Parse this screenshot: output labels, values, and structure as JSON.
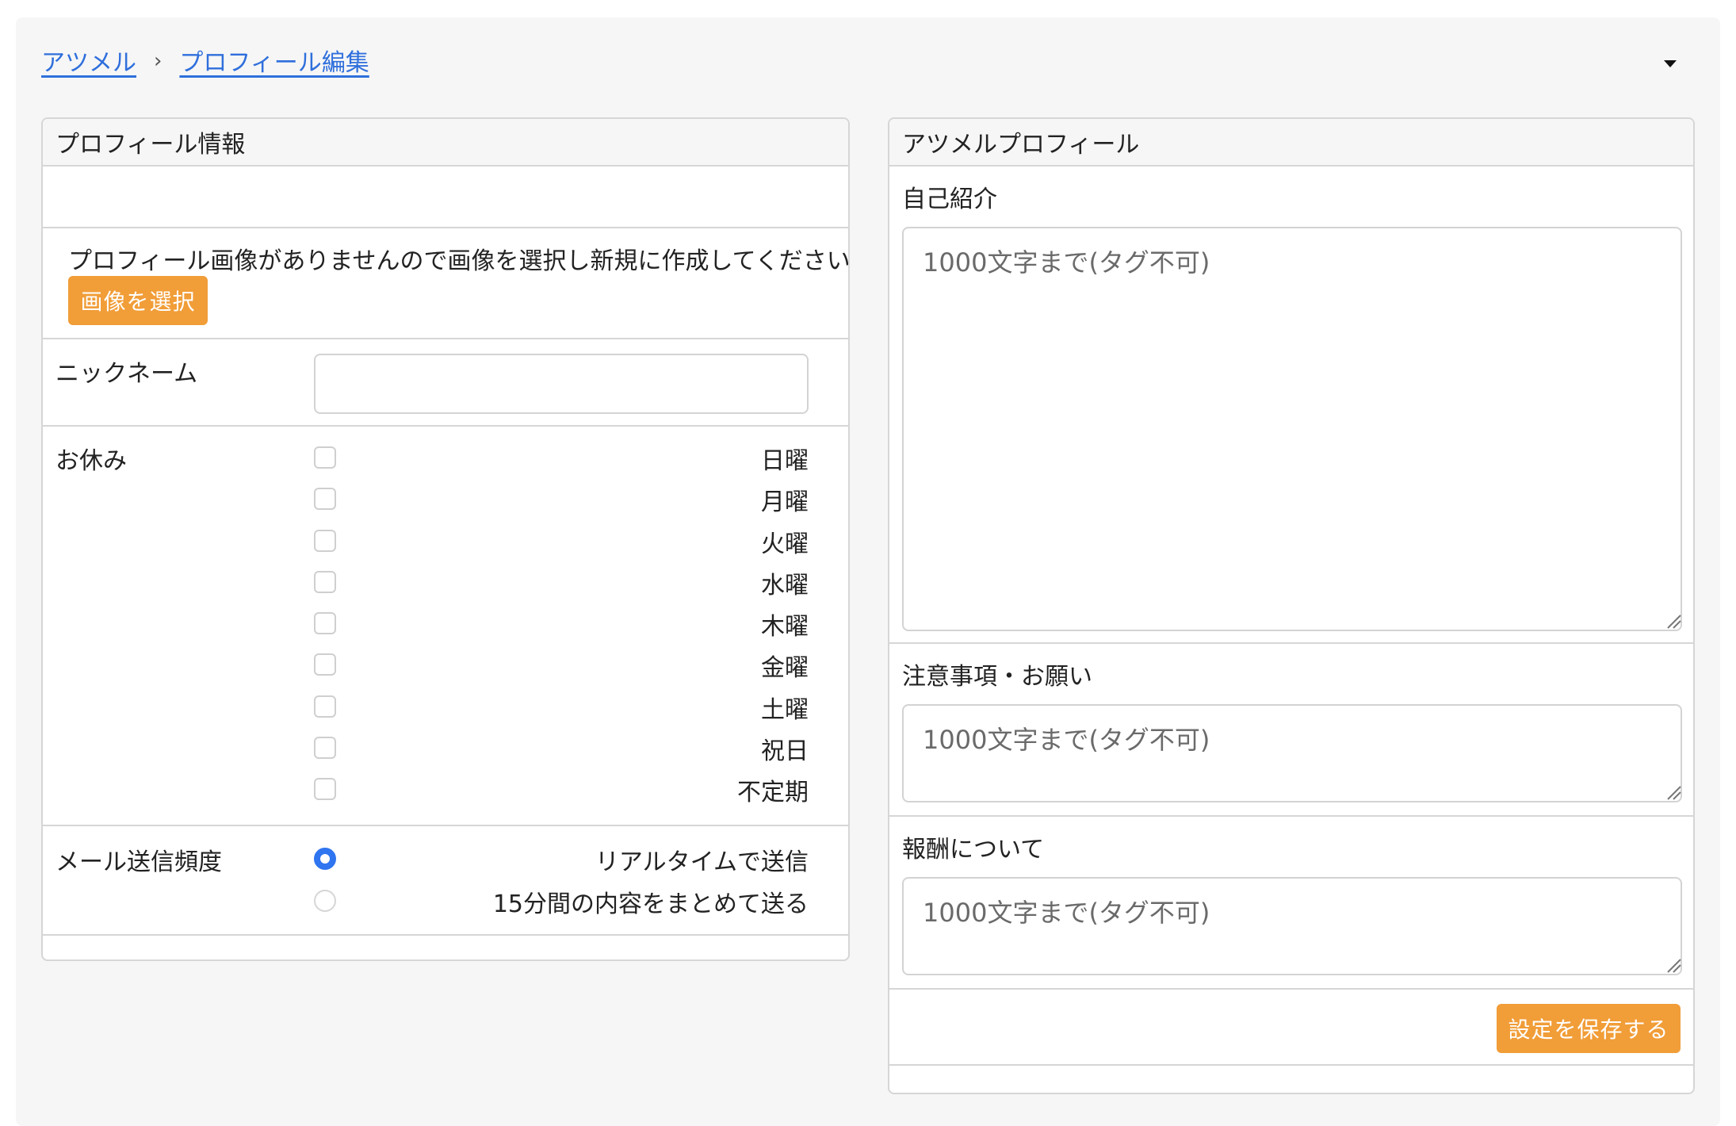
{
  "breadcrumb": {
    "home": "アツメル",
    "separator": "›",
    "current": "プロフィール編集"
  },
  "header": {
    "dropdown_icon": "caret-down-icon"
  },
  "left_panel": {
    "title": "プロフィール情報",
    "image_message": "プロフィール画像がありませんので画像を選択し新規に作成してください",
    "select_image_button": "画像を選択",
    "nickname": {
      "label": "ニックネーム",
      "value": "",
      "placeholder": ""
    },
    "holidays": {
      "label": "お休み",
      "options": [
        {
          "label": "日曜",
          "checked": false
        },
        {
          "label": "月曜",
          "checked": false
        },
        {
          "label": "火曜",
          "checked": false
        },
        {
          "label": "水曜",
          "checked": false
        },
        {
          "label": "木曜",
          "checked": false
        },
        {
          "label": "金曜",
          "checked": false
        },
        {
          "label": "土曜",
          "checked": false
        },
        {
          "label": "祝日",
          "checked": false
        },
        {
          "label": "不定期",
          "checked": false
        }
      ]
    },
    "mail_frequency": {
      "label": "メール送信頻度",
      "options": [
        {
          "label": "リアルタイムで送信",
          "selected": true
        },
        {
          "label": "15分間の内容をまとめて送る",
          "selected": false
        }
      ]
    }
  },
  "right_panel": {
    "title": "アツメルプロフィール",
    "self_intro": {
      "label": "自己紹介",
      "placeholder": "1000文字まで(タグ不可)",
      "value": ""
    },
    "notes": {
      "label": "注意事項・お願い",
      "placeholder": "1000文字まで(タグ不可)",
      "value": ""
    },
    "reward": {
      "label": "報酬について",
      "placeholder": "1000文字まで(タグ不可)",
      "value": ""
    },
    "save_button": "設定を保存する"
  },
  "colors": {
    "accent_orange": "#f19d38",
    "link_blue": "#2f6fdc",
    "radio_blue": "#2f75f0"
  }
}
